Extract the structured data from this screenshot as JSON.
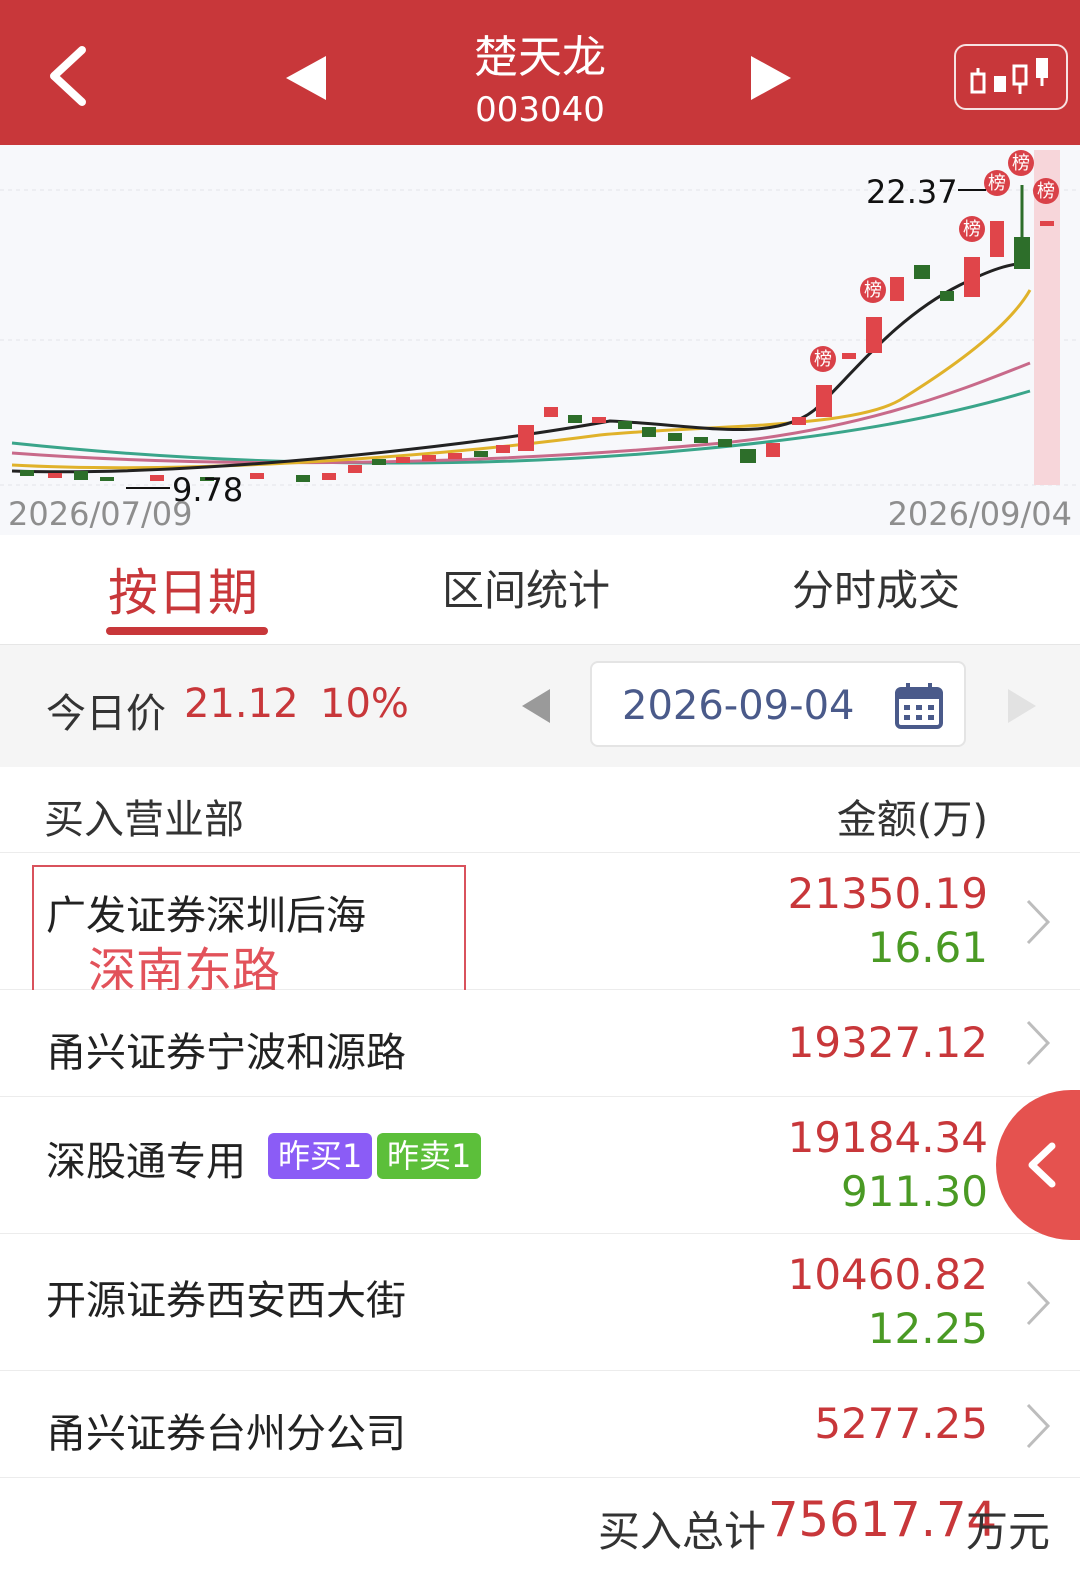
{
  "header": {
    "stock_name": "楚天龙",
    "stock_code": "003040",
    "back_icon": "chevron-left-icon",
    "prev_icon": "triangle-left-icon",
    "next_icon": "triangle-right-icon",
    "kline_icon": "candlestick-icon"
  },
  "chart": {
    "start_date": "2026/07/09",
    "end_date": "2026/09/04",
    "high_label": "22.37",
    "low_label": "9.78",
    "marker_label": "榜",
    "colors": {
      "up": "#e0454a",
      "down": "#2d6e2a",
      "ma5": "#222222",
      "ma10": "#e0b22a",
      "ma20": "#c86a8a",
      "ma30": "#3aa58a"
    }
  },
  "tabs": [
    {
      "label": "按日期",
      "active": true
    },
    {
      "label": "区间统计",
      "active": false
    },
    {
      "label": "分时成交",
      "active": false
    }
  ],
  "price_row": {
    "label": "今日价",
    "price": "21.12",
    "change": "10%",
    "date": "2026-09-04"
  },
  "table": {
    "left_header": "买入营业部",
    "right_header": "金额(万)",
    "rows": [
      {
        "name": "广发证券深圳后海",
        "name_cont": "深南东路",
        "buy": "21350.19",
        "sell": "16.61"
      },
      {
        "name": "甬兴证券宁波和源路",
        "buy": "19327.12"
      },
      {
        "name": "深股通专用",
        "badge_buy": "昨买1",
        "badge_sell": "昨卖1",
        "buy": "19184.34",
        "sell": "911.30"
      },
      {
        "name": "开源证券西安西大街",
        "buy": "10460.82",
        "sell": "12.25"
      },
      {
        "name": "甬兴证券台州分公司",
        "buy": "5277.25"
      }
    ]
  },
  "total": {
    "label": "买入总计",
    "value": "75617.74",
    "unit": "万元"
  }
}
